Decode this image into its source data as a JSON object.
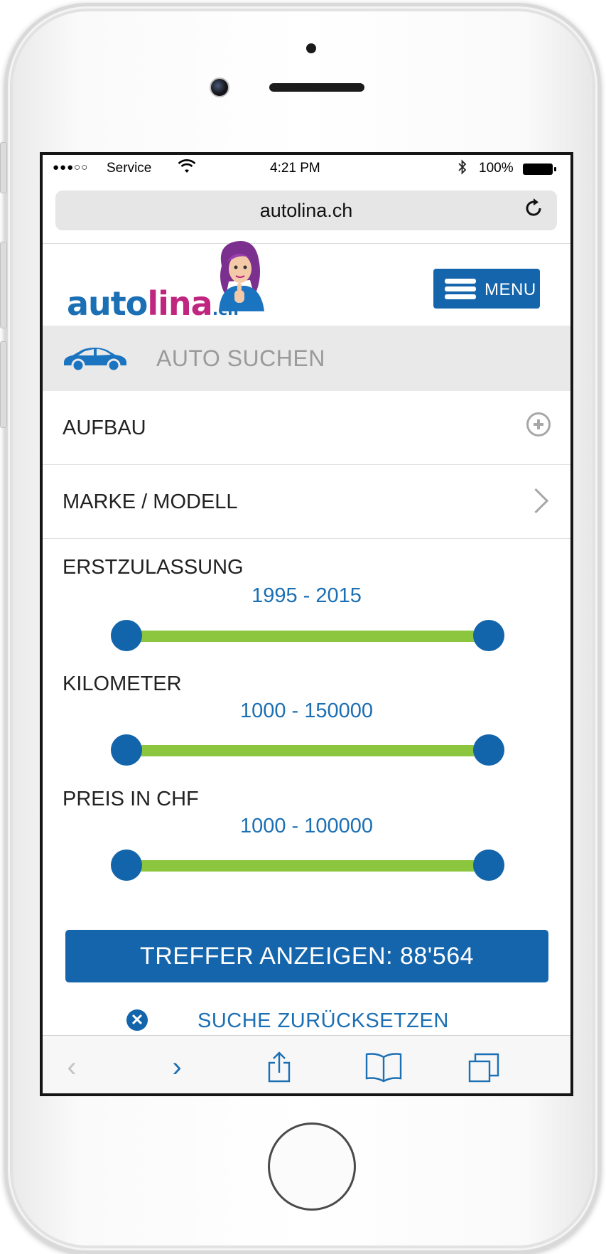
{
  "status_bar": {
    "signal": "●●●○○",
    "carrier": "Service",
    "wifi_icon": "wifi-icon",
    "time": "4:21 PM",
    "bluetooth_icon": "bluetooth-icon",
    "battery_percent": "100%"
  },
  "browser": {
    "url": "autolina.ch",
    "reload_icon": "reload-icon"
  },
  "site": {
    "logo_part_1": "auto",
    "logo_part_2": "lina",
    "logo_part_3": ".ch",
    "menu_label": "MENU",
    "search_title": "AUTO SUCHEN"
  },
  "filters": {
    "body_label": "AUFBAU",
    "make_model_label": "MARKE / MODELL"
  },
  "sliders": [
    {
      "label": "ERSTZULASSUNG",
      "value_text": "1995 - 2015",
      "min_fraction": 0,
      "max_fraction": 1
    },
    {
      "label": "KILOMETER",
      "value_text": "1000 - 150000",
      "min_fraction": 0,
      "max_fraction": 1
    },
    {
      "label": "PREIS IN CHF",
      "value_text": "1000 - 100000",
      "min_fraction": 0,
      "max_fraction": 1
    }
  ],
  "actions": {
    "show_results": "TREFFER ANZEIGEN: 88'564",
    "reset_search": "SUCHE ZURÜCKSETZEN"
  },
  "toolbar": {
    "back": "‹",
    "forward": "›",
    "share_icon": "share-icon",
    "bookmarks_icon": "bookmarks-icon",
    "tabs_icon": "tabs-icon"
  },
  "colors": {
    "brand_blue": "#1565ac",
    "brand_pink": "#c0257f",
    "slider_green": "#8cc63f"
  }
}
